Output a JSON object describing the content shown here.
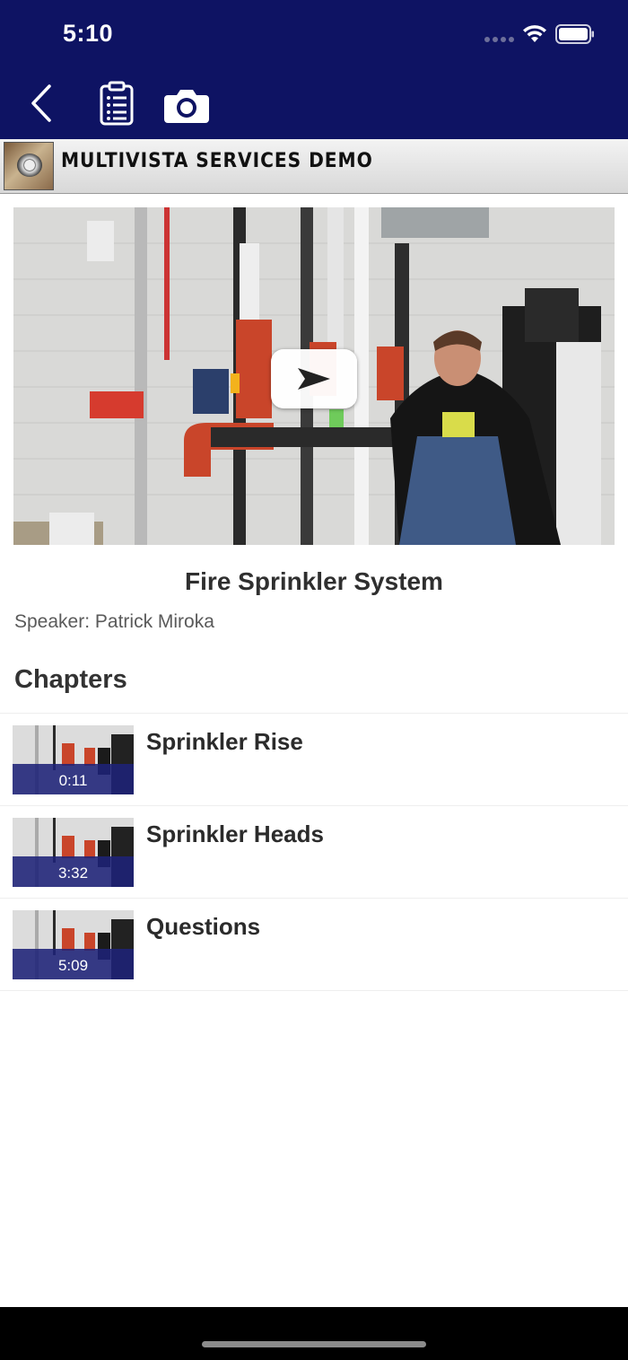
{
  "status_bar": {
    "time": "5:10"
  },
  "nav": {
    "back_icon": "chevron-left-icon",
    "report_icon": "clipboard-list-icon",
    "camera_icon": "camera-icon"
  },
  "project": {
    "title": "MULTIVISTA SERVICES DEMO"
  },
  "video": {
    "title": "Fire Sprinkler System",
    "speaker": "Speaker: Patrick Miroka"
  },
  "chapters_heading": "Chapters",
  "chapters": [
    {
      "title": "Sprinkler Rise",
      "time": "0:11"
    },
    {
      "title": "Sprinkler Heads",
      "time": "3:32"
    },
    {
      "title": "Questions",
      "time": "5:09"
    }
  ],
  "colors": {
    "nav_bg": "#0e1363",
    "chapter_band": "#1e2278"
  }
}
